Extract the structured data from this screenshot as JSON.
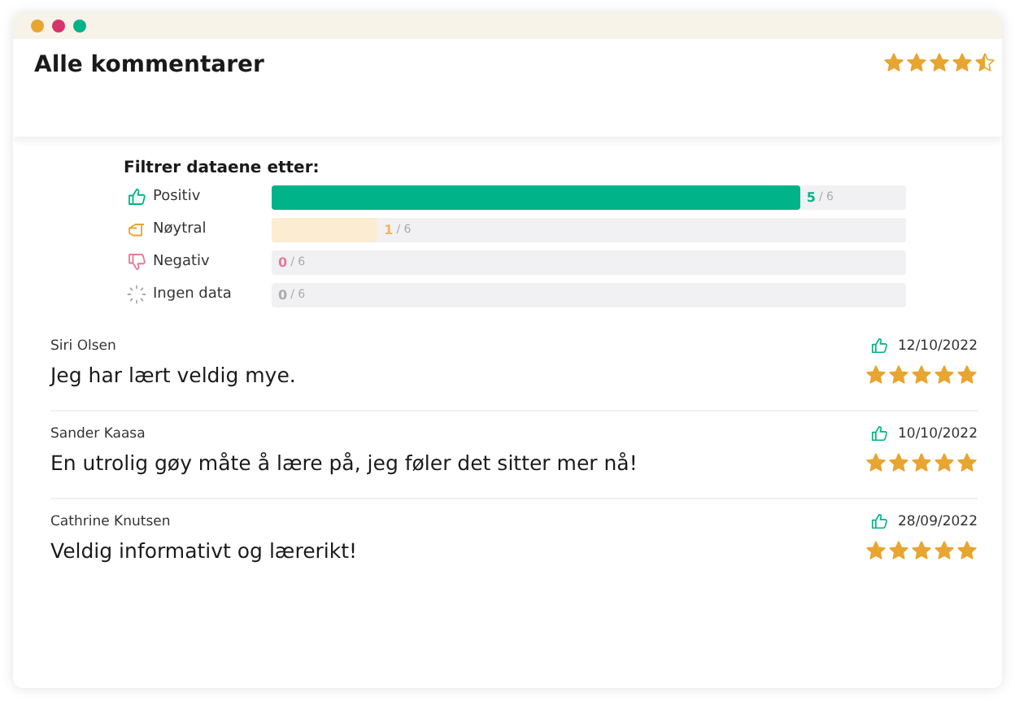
{
  "window": {
    "title": "Alle kommentarer",
    "stars": 4.5
  },
  "filter": {
    "heading": "Filtrer dataene etter:",
    "options": [
      {
        "kind": "positive",
        "label": "Positiv",
        "count": "5",
        "total": "/ 6",
        "level": 0.833,
        "color": "#00b388"
      },
      {
        "kind": "neutral",
        "label": "Nøytral",
        "count": "1",
        "total": "/ 6",
        "level": 0.167,
        "color": "#f0b860"
      },
      {
        "kind": "negative",
        "label": "Negativ",
        "count": "0",
        "total": "/ 6",
        "color": "#e8789a"
      },
      {
        "kind": "none",
        "label": "Ingen data",
        "count": "0",
        "total": "/ 6",
        "color": "#aaaaaa"
      }
    ]
  },
  "comments": [
    {
      "author": "Siri Olsen",
      "date": "12/10/2022",
      "text": "Jeg har lært veldig mye.",
      "stars": 5
    },
    {
      "author": "Sander Kaasa",
      "date": "10/10/2022",
      "text": "En utrolig gøy måte å lære på, jeg føler det sitter mer nå!",
      "stars": 5
    },
    {
      "author": "Cathrine Knutsen",
      "date": "28/09/2022",
      "text": "Veldig informativt og lærerikt!",
      "stars": 5
    }
  ]
}
